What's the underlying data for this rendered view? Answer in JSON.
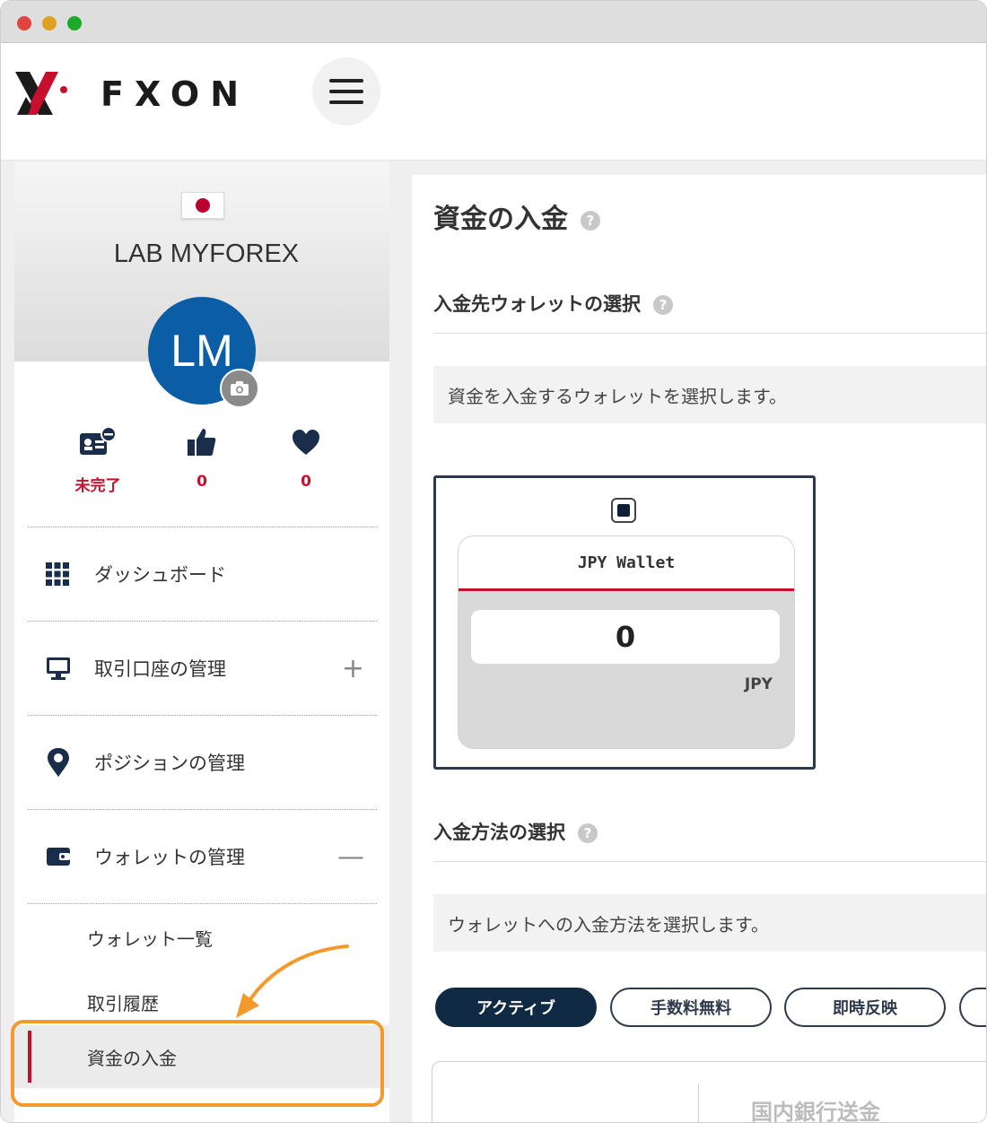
{
  "header": {
    "logo_text": "FXON",
    "menu_icon": "hamburger-menu-icon"
  },
  "profile": {
    "flag": "japan-flag",
    "username": "LAB MYFOREX",
    "avatar_initials": "LM",
    "stats": [
      {
        "icon": "id-card-icon",
        "label": "未完了"
      },
      {
        "icon": "thumbs-up-icon",
        "label": "0"
      },
      {
        "icon": "heart-icon",
        "label": "0"
      }
    ]
  },
  "sidebar": {
    "items": [
      {
        "icon": "grid-icon",
        "label": "ダッシュボード",
        "toggle": ""
      },
      {
        "icon": "monitor-icon",
        "label": "取引口座の管理",
        "toggle": "+"
      },
      {
        "icon": "map-pin-icon",
        "label": "ポジションの管理",
        "toggle": ""
      },
      {
        "icon": "wallet-icon",
        "label": "ウォレットの管理",
        "toggle": "—"
      }
    ],
    "sub_items": [
      {
        "label": "ウォレット一覧"
      },
      {
        "label": "取引履歴"
      },
      {
        "label": "資金の入金",
        "active": true
      }
    ]
  },
  "main": {
    "title": "資金の入金",
    "help": "?",
    "section_wallet": {
      "title": "入金先ウォレットの選択",
      "description": "資金を入金するウォレットを選択します。"
    },
    "wallet": {
      "name": "JPY Wallet",
      "amount": "0",
      "currency": "JPY",
      "selected": true
    },
    "section_method": {
      "title": "入金方法の選択",
      "description": "ウォレットへの入金方法を選択します。"
    },
    "filters": [
      {
        "label": "アクティブ",
        "active": true
      },
      {
        "label": "手数料無料",
        "active": false
      },
      {
        "label": "即時反映",
        "active": false
      }
    ],
    "method_option": "国内銀行送金"
  },
  "colors": {
    "brand_red": "#c8102e",
    "brand_navy": "#102a43",
    "avatar_blue": "#0b5da5",
    "highlight_orange": "#f29a2e"
  }
}
